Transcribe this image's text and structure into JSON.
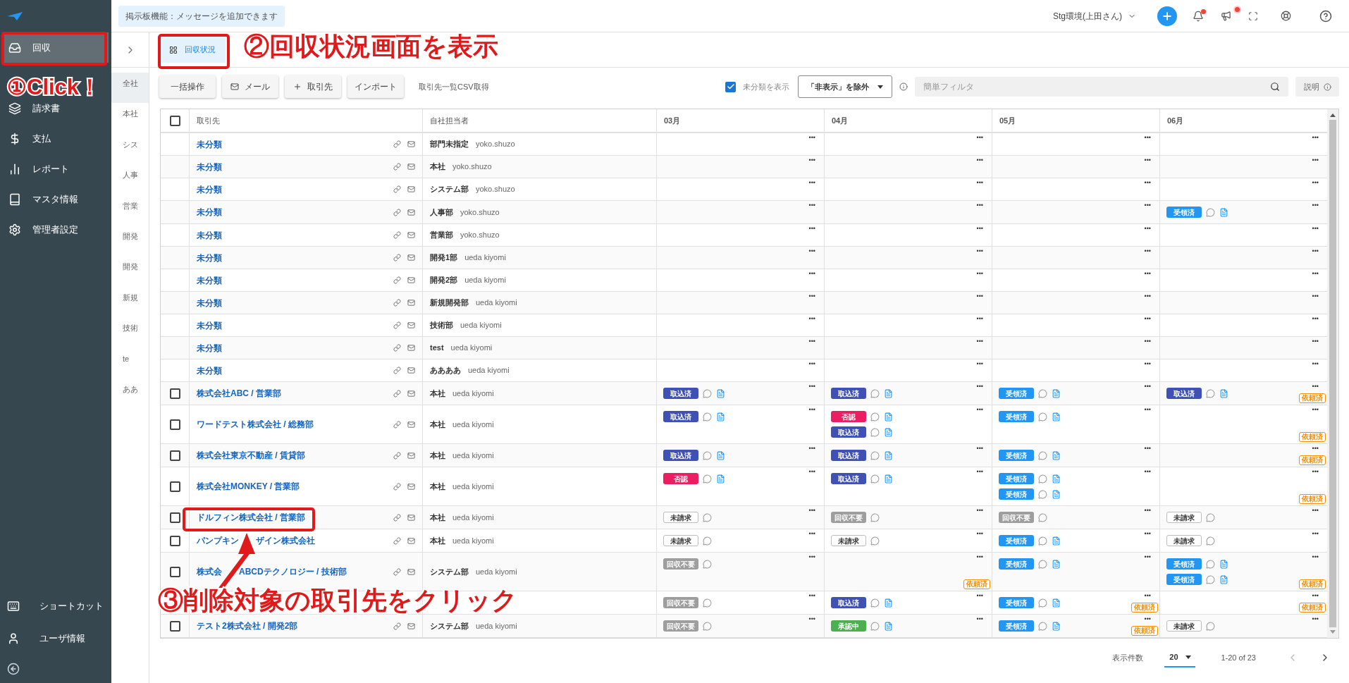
{
  "sidebar": {
    "items": [
      {
        "label": "回収",
        "selected": true
      },
      {
        "label": "請求書",
        "selected": false
      },
      {
        "label": "支払",
        "selected": false
      },
      {
        "label": "レポート",
        "selected": false
      },
      {
        "label": "マスタ情報",
        "selected": false
      },
      {
        "label": "管理者設定",
        "selected": false
      }
    ],
    "bottom_items": [
      {
        "label": "ショートカット"
      },
      {
        "label": "ユーザ情報"
      }
    ]
  },
  "topbar": {
    "notice": "掲示板機能：メッセージを追加できます",
    "environment": "Stg環境(上田さん)"
  },
  "groups": [
    {
      "label": "全社",
      "selected": true
    },
    {
      "label": "本社",
      "selected": false
    },
    {
      "label": "シス",
      "selected": false
    },
    {
      "label": "人事",
      "selected": false
    },
    {
      "label": "営業",
      "selected": false
    },
    {
      "label": "開発",
      "selected": false
    },
    {
      "label": "開発",
      "selected": false
    },
    {
      "label": "新規",
      "selected": false
    },
    {
      "label": "技術",
      "selected": false
    },
    {
      "label": "te",
      "selected": false
    },
    {
      "label": "ああ",
      "selected": false
    }
  ],
  "tabs": [
    {
      "label": "回収状況",
      "selected": true
    }
  ],
  "toolbar": {
    "buttons": [
      "一括操作",
      "メール",
      "取引先",
      "インポート"
    ],
    "csv_link": "取引先一覧CSV取得",
    "show_unclassified": {
      "label": "未分類を表示",
      "checked": true
    },
    "filter_select": "「非表示」を除外",
    "search": {
      "placeholder": "簡単フィルタ"
    },
    "help_button": "説明"
  },
  "table": {
    "select_all": {
      "checked": false
    },
    "columns": [
      "取引先",
      "自社担当者",
      "03月",
      "04月",
      "05月",
      "06月"
    ],
    "rows": [
      {
        "client": "未分類",
        "department": "部門未指定",
        "staff": "yoko.shuzo",
        "months": [
          {
            "menu": "•••"
          },
          {
            "menu": "•••"
          },
          {
            "menu": "•••"
          },
          {
            "menu": "•••"
          }
        ]
      },
      {
        "client": "未分類",
        "department": "本社",
        "staff": "yoko.shuzo",
        "months": [
          {
            "menu": "•••"
          },
          {
            "menu": "•••"
          },
          {
            "menu": "•••"
          },
          {
            "menu": "•••"
          }
        ]
      },
      {
        "client": "未分類",
        "department": "システム部",
        "staff": "yoko.shuzo",
        "months": [
          {
            "menu": "•••"
          },
          {
            "menu": "•••"
          },
          {
            "menu": "•••"
          },
          {
            "menu": "•••"
          }
        ]
      },
      {
        "client": "未分類",
        "department": "人事部",
        "staff": "yoko.shuzo",
        "months": [
          {
            "menu": "•••"
          },
          {
            "menu": "•••"
          },
          {
            "menu": "•••"
          },
          {
            "menu": "•••",
            "tags": [
              {
                "label": "受領済",
                "kind": "filled",
                "color": "#2196f3",
                "doc": true
              }
            ]
          }
        ]
      },
      {
        "client": "未分類",
        "department": "営業部",
        "staff": "yoko.shuzo",
        "months": [
          {
            "menu": "•••"
          },
          {
            "menu": "•••"
          },
          {
            "menu": "•••"
          },
          {
            "menu": "•••"
          }
        ]
      },
      {
        "client": "未分類",
        "department": "開発1部",
        "staff": "ueda kiyomi",
        "months": [
          {
            "menu": "•••"
          },
          {
            "menu": "•••"
          },
          {
            "menu": "•••"
          },
          {
            "menu": "•••"
          }
        ]
      },
      {
        "client": "未分類",
        "department": "開発2部",
        "staff": "ueda kiyomi",
        "months": [
          {
            "menu": "•••"
          },
          {
            "menu": "•••"
          },
          {
            "menu": "•••"
          },
          {
            "menu": "•••"
          }
        ]
      },
      {
        "client": "未分類",
        "department": "新規開発部",
        "staff": "ueda kiyomi",
        "months": [
          {
            "menu": "•••"
          },
          {
            "menu": "•••"
          },
          {
            "menu": "•••"
          },
          {
            "menu": "•••"
          }
        ]
      },
      {
        "client": "未分類",
        "department": "技術部",
        "staff": "ueda kiyomi",
        "months": [
          {
            "menu": "•••"
          },
          {
            "menu": "•••"
          },
          {
            "menu": "•••"
          },
          {
            "menu": "•••"
          }
        ]
      },
      {
        "client": "未分類",
        "department": "test",
        "staff": "ueda kiyomi",
        "months": [
          {
            "menu": "•••"
          },
          {
            "menu": "•••"
          },
          {
            "menu": "•••"
          },
          {
            "menu": "•••"
          }
        ]
      },
      {
        "client": "未分類",
        "department": "ああああ",
        "staff": "ueda kiyomi",
        "months": [
          {
            "menu": "•••"
          },
          {
            "menu": "•••"
          },
          {
            "menu": "•••"
          },
          {
            "menu": "•••"
          }
        ]
      },
      {
        "checked": false,
        "client": "株式会社ABC / 営業部",
        "department": "本社",
        "staff": "ueda kiyomi",
        "months": [
          {
            "menu": "•••",
            "tags": [
              {
                "label": "取込済",
                "kind": "filled",
                "color": "#3f51b5",
                "doc": true
              }
            ]
          },
          {
            "menu": "•••",
            "tags": [
              {
                "label": "取込済",
                "kind": "filled",
                "color": "#3f51b5",
                "doc": true
              }
            ]
          },
          {
            "menu": "•••",
            "tags": [
              {
                "label": "受領済",
                "kind": "filled",
                "color": "#2196f3",
                "doc": true
              }
            ]
          },
          {
            "menu": "•••",
            "tags": [
              {
                "label": "取込済",
                "kind": "filled",
                "color": "#3f51b5",
                "doc": true
              }
            ],
            "badge": "依頼済"
          }
        ]
      },
      {
        "checked": false,
        "client": "ワードテスト株式会社 / 総務部",
        "department": "本社",
        "staff": "ueda kiyomi",
        "months": [
          {
            "menu": "•••",
            "tags": [
              {
                "label": "取込済",
                "kind": "filled",
                "color": "#3f51b5",
                "doc": true
              }
            ]
          },
          {
            "menu": "•••",
            "tags": [
              {
                "label": "否認",
                "kind": "filled",
                "color": "#e91e63",
                "doc": true
              },
              {
                "label": "取込済",
                "kind": "filled",
                "color": "#3f51b5",
                "doc": true
              }
            ]
          },
          {
            "menu": "•••",
            "tags": [
              {
                "label": "受領済",
                "kind": "filled",
                "color": "#2196f3",
                "doc": true
              }
            ]
          },
          {
            "menu": "•••",
            "badge": "依頼済"
          }
        ]
      },
      {
        "checked": false,
        "client": "株式会社東京不動産 / 賃貸部",
        "department": "本社",
        "staff": "ueda kiyomi",
        "months": [
          {
            "menu": "•••",
            "tags": [
              {
                "label": "取込済",
                "kind": "filled",
                "color": "#3f51b5",
                "doc": true
              }
            ]
          },
          {
            "menu": "•••",
            "tags": [
              {
                "label": "取込済",
                "kind": "filled",
                "color": "#3f51b5",
                "doc": true
              }
            ]
          },
          {
            "menu": "•••",
            "tags": [
              {
                "label": "受領済",
                "kind": "filled",
                "color": "#2196f3",
                "doc": true
              }
            ]
          },
          {
            "menu": "•••",
            "badge": "依頼済"
          }
        ]
      },
      {
        "checked": false,
        "client": "株式会社MONKEY / 営業部",
        "department": "本社",
        "staff": "ueda kiyomi",
        "months": [
          {
            "menu": "•••",
            "tags": [
              {
                "label": "否認",
                "kind": "filled",
                "color": "#e91e63",
                "doc": true
              }
            ]
          },
          {
            "menu": "•••",
            "tags": [
              {
                "label": "取込済",
                "kind": "filled",
                "color": "#3f51b5",
                "doc": true
              }
            ]
          },
          {
            "menu": "•••",
            "tags": [
              {
                "label": "受領済",
                "kind": "filled",
                "color": "#2196f3",
                "doc": true
              },
              {
                "label": "受領済",
                "kind": "filled",
                "color": "#2196f3",
                "doc": true
              }
            ]
          },
          {
            "menu": "•••",
            "badge": "依頼済"
          }
        ]
      },
      {
        "checked": false,
        "client": "ドルフィン株式会社 / 営業部",
        "department": "本社",
        "staff": "ueda kiyomi",
        "months": [
          {
            "menu": "•••",
            "tags": [
              {
                "label": "未請求",
                "kind": "outline",
                "doc": false
              }
            ]
          },
          {
            "menu": "•••",
            "tags": [
              {
                "label": "回収不要",
                "kind": "filled",
                "color": "#9e9e9e",
                "doc": false
              }
            ]
          },
          {
            "menu": "•••",
            "tags": [
              {
                "label": "回収不要",
                "kind": "filled",
                "color": "#9e9e9e",
                "doc": false
              }
            ]
          },
          {
            "menu": "•••",
            "tags": [
              {
                "label": "未請求",
                "kind": "outline",
                "doc": false
              }
            ]
          }
        ]
      },
      {
        "checked": false,
        "client_parts": [
          "パンプキン",
          "ザイン株式会社"
        ],
        "department": "本社",
        "staff": "ueda kiyomi",
        "months": [
          {
            "menu": "•••",
            "tags": [
              {
                "label": "未請求",
                "kind": "outline",
                "doc": false
              }
            ]
          },
          {
            "menu": "•••",
            "tags": [
              {
                "label": "未請求",
                "kind": "outline",
                "doc": false
              }
            ]
          },
          {
            "menu": "•••",
            "tags": [
              {
                "label": "受領済",
                "kind": "filled",
                "color": "#2196f3",
                "doc": true
              }
            ]
          },
          {
            "menu": "•••",
            "tags": [
              {
                "label": "未請求",
                "kind": "outline",
                "doc": false
              }
            ]
          }
        ]
      },
      {
        "checked": false,
        "client_parts": [
          "株式会",
          "ABCDテクノロジー / 技術部"
        ],
        "department": "システム部",
        "staff": "ueda kiyomi",
        "months": [
          {
            "menu": "•••",
            "tags": [
              {
                "label": "回収不要",
                "kind": "filled",
                "color": "#9e9e9e",
                "doc": false
              }
            ]
          },
          {
            "menu": "•••",
            "badge": "依頼済"
          },
          {
            "menu": "•••",
            "tags": [
              {
                "label": "受領済",
                "kind": "filled",
                "color": "#2196f3",
                "doc": true
              }
            ]
          },
          {
            "menu": "•••",
            "tags": [
              {
                "label": "受領済",
                "kind": "filled",
                "color": "#2196f3",
                "doc": true
              },
              {
                "label": "受領済",
                "kind": "filled",
                "color": "#2196f3",
                "doc": true
              }
            ],
            "badge": "依頼済"
          }
        ]
      },
      {
        "months": [
          {
            "menu": "•••",
            "tags": [
              {
                "label": "回収不要",
                "kind": "filled",
                "color": "#9e9e9e",
                "doc": false
              }
            ]
          },
          {
            "menu": "•••",
            "tags": [
              {
                "label": "取込済",
                "kind": "filled",
                "color": "#3f51b5",
                "doc": true
              }
            ]
          },
          {
            "menu": "•••",
            "tags": [
              {
                "label": "受領済",
                "kind": "filled",
                "color": "#2196f3",
                "doc": true
              }
            ],
            "badge": "依頼済"
          },
          {
            "menu": "•••",
            "badge": "依頼済"
          }
        ]
      },
      {
        "checked": false,
        "client": "テスト2株式会社 / 開発2部",
        "department": "システム部",
        "staff": "ueda kiyomi",
        "months": [
          {
            "menu": "•••",
            "tags": [
              {
                "label": "回収不要",
                "kind": "filled",
                "color": "#9e9e9e",
                "doc": false
              }
            ]
          },
          {
            "menu": "•••",
            "tags": [
              {
                "label": "承認中",
                "kind": "filled",
                "color": "#4caf50",
                "doc": true
              }
            ]
          },
          {
            "menu": "•••",
            "tags": [
              {
                "label": "受領済",
                "kind": "filled",
                "color": "#2196f3",
                "doc": true
              }
            ],
            "badge": "依頼済"
          },
          {
            "menu": "•••",
            "tags": [
              {
                "label": "未請求",
                "kind": "outline",
                "doc": false
              }
            ]
          }
        ]
      }
    ]
  },
  "pagination": {
    "label": "表示件数",
    "page_size": "20",
    "range": "1-20 of 23"
  },
  "annotations": [
    {
      "kind": "step",
      "text": "①Click！"
    },
    {
      "kind": "step",
      "text": "②回収状況画面を表示"
    },
    {
      "kind": "step",
      "text": "③削除対象の取引先をクリック"
    }
  ]
}
